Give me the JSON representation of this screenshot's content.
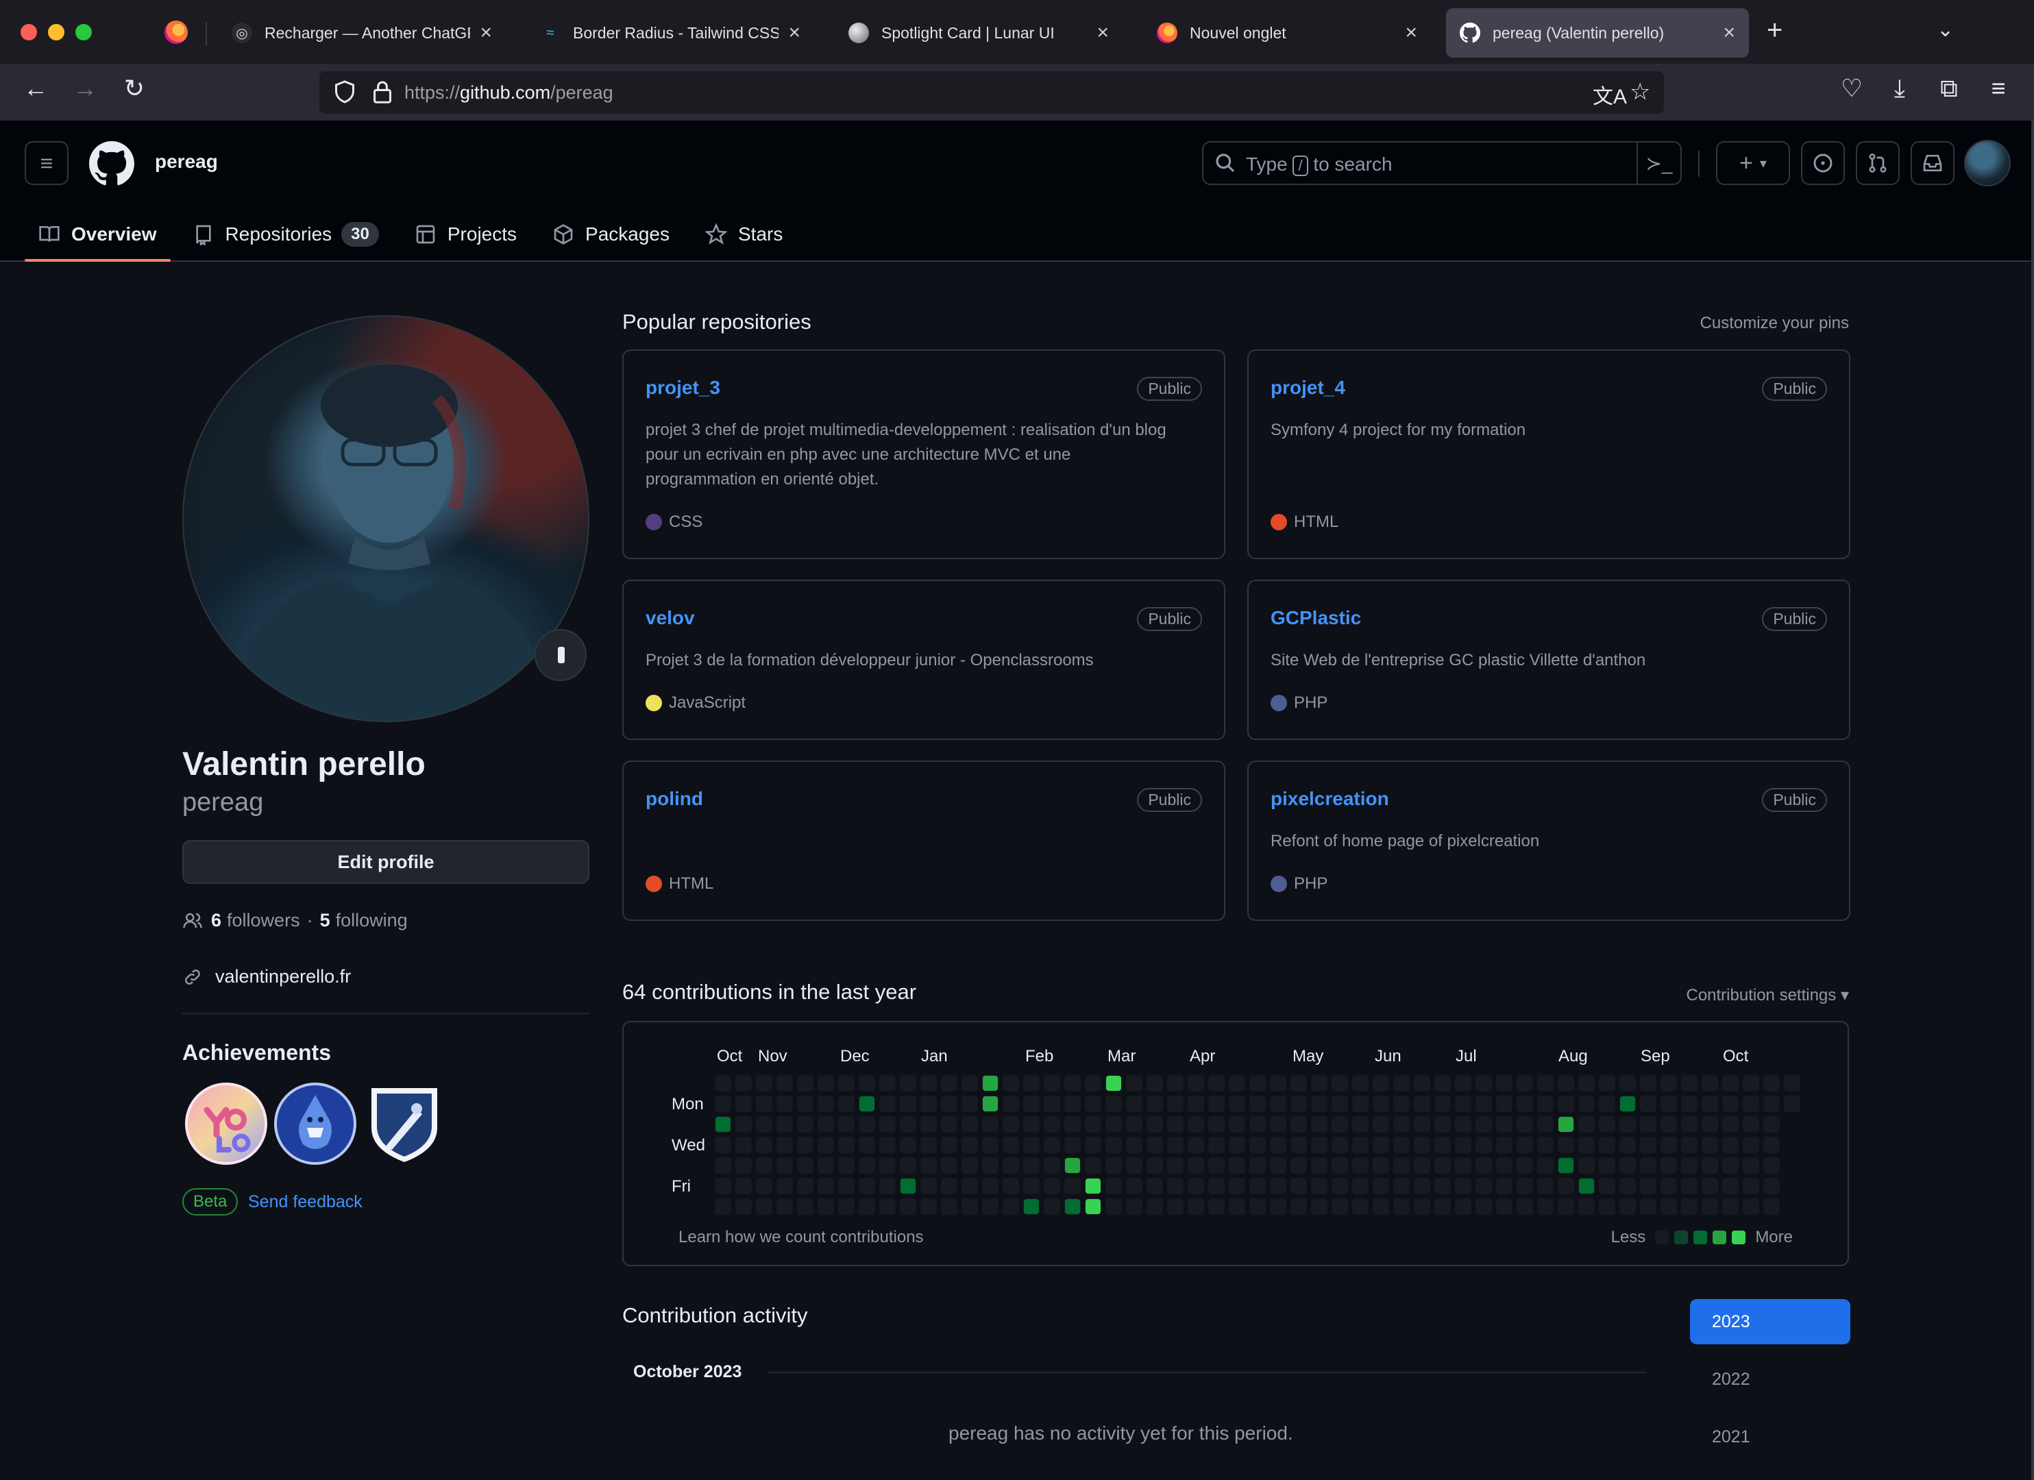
{
  "browser": {
    "tabs": [
      {
        "title": "Recharger — Another ChatGPT",
        "icon": "chatgpt-icon"
      },
      {
        "title": "Border Radius - Tailwind CSS",
        "icon": "tailwind-icon"
      },
      {
        "title": "Spotlight Card | Lunar UI",
        "icon": "lunar-icon"
      },
      {
        "title": "Nouvel onglet",
        "icon": "firefox-icon"
      },
      {
        "title": "pereag (Valentin perello)",
        "icon": "github-icon"
      }
    ],
    "url_prefix": "https://",
    "url_host": "github.com",
    "url_path": "/pereag"
  },
  "header": {
    "user": "pereag",
    "search_placeholder_before": "Type ",
    "search_slash": "/",
    "search_placeholder_after": " to search"
  },
  "nav_tabs": [
    {
      "label": "Overview"
    },
    {
      "label": "Repositories",
      "count": "30"
    },
    {
      "label": "Projects"
    },
    {
      "label": "Packages"
    },
    {
      "label": "Stars"
    }
  ],
  "profile": {
    "name": "Valentin perello",
    "login": "pereag",
    "edit_label": "Edit profile",
    "followers_count": "6",
    "followers_label": "followers",
    "separator": "·",
    "following_count": "5",
    "following_label": "following",
    "website": "valentinperello.fr",
    "achievements_title": "Achievements",
    "achievements": [
      "yolo-badge",
      "pull-shark-badge",
      "arctic-code-vault-badge"
    ],
    "beta_label": "Beta",
    "feedback_label": "Send feedback"
  },
  "popular": {
    "title": "Popular repositories",
    "customize": "Customize your pins",
    "repos": [
      {
        "name": "projet_3",
        "visibility": "Public",
        "description": "projet 3 chef de projet multimedia-developpement : realisation d'un blog pour un ecrivain en php avec une architecture MVC et une programmation en orienté objet.",
        "language": "CSS",
        "lang_color": "#563d7c"
      },
      {
        "name": "projet_4",
        "visibility": "Public",
        "description": "Symfony 4 project for my formation",
        "language": "HTML",
        "lang_color": "#e34c26"
      },
      {
        "name": "velov",
        "visibility": "Public",
        "description": "Projet 3 de la formation développeur junior - Openclassrooms",
        "language": "JavaScript",
        "lang_color": "#f1e05a"
      },
      {
        "name": "GCPlastic",
        "visibility": "Public",
        "description": "Site Web de l'entreprise GC plastic Villette d'anthon",
        "language": "PHP",
        "lang_color": "#4F5D95"
      },
      {
        "name": "polind",
        "visibility": "Public",
        "description": "",
        "language": "HTML",
        "lang_color": "#e34c26"
      },
      {
        "name": "pixelcreation",
        "visibility": "Public",
        "description": "Refont of home page of pixelcreation",
        "language": "PHP",
        "lang_color": "#4F5D95"
      }
    ]
  },
  "contributions": {
    "title": "64 contributions in the last year",
    "settings": "Contribution settings ▾",
    "months": [
      "Oct",
      "Nov",
      "Dec",
      "Jan",
      "Feb",
      "Mar",
      "Apr",
      "May",
      "Jun",
      "Jul",
      "Aug",
      "Sep",
      "Oct"
    ],
    "days": [
      "Mon",
      "Wed",
      "Fri"
    ],
    "learn": "Learn how we count contributions",
    "less": "Less",
    "more": "More",
    "level_colors": [
      "#161b22",
      "#0e4429",
      "#006d32",
      "#26a641",
      "#39d353"
    ],
    "active_cells": [
      {
        "week": 0,
        "day": 2,
        "level": 2
      },
      {
        "week": 7,
        "day": 1,
        "level": 2
      },
      {
        "week": 9,
        "day": 5,
        "level": 2
      },
      {
        "week": 13,
        "day": 0,
        "level": 3
      },
      {
        "week": 13,
        "day": 1,
        "level": 3
      },
      {
        "week": 15,
        "day": 6,
        "level": 2
      },
      {
        "week": 17,
        "day": 4,
        "level": 3
      },
      {
        "week": 17,
        "day": 6,
        "level": 2
      },
      {
        "week": 18,
        "day": 5,
        "level": 4
      },
      {
        "week": 18,
        "day": 6,
        "level": 4
      },
      {
        "week": 19,
        "day": 0,
        "level": 4
      },
      {
        "week": 41,
        "day": 2,
        "level": 3
      },
      {
        "week": 41,
        "day": 4,
        "level": 2
      },
      {
        "week": 42,
        "day": 5,
        "level": 2
      },
      {
        "week": 44,
        "day": 1,
        "level": 2
      }
    ]
  },
  "activity": {
    "title": "Contribution activity",
    "month": "October 2023",
    "empty": "pereag has no activity yet for this period.",
    "years": [
      "2023",
      "2022",
      "2021"
    ]
  }
}
